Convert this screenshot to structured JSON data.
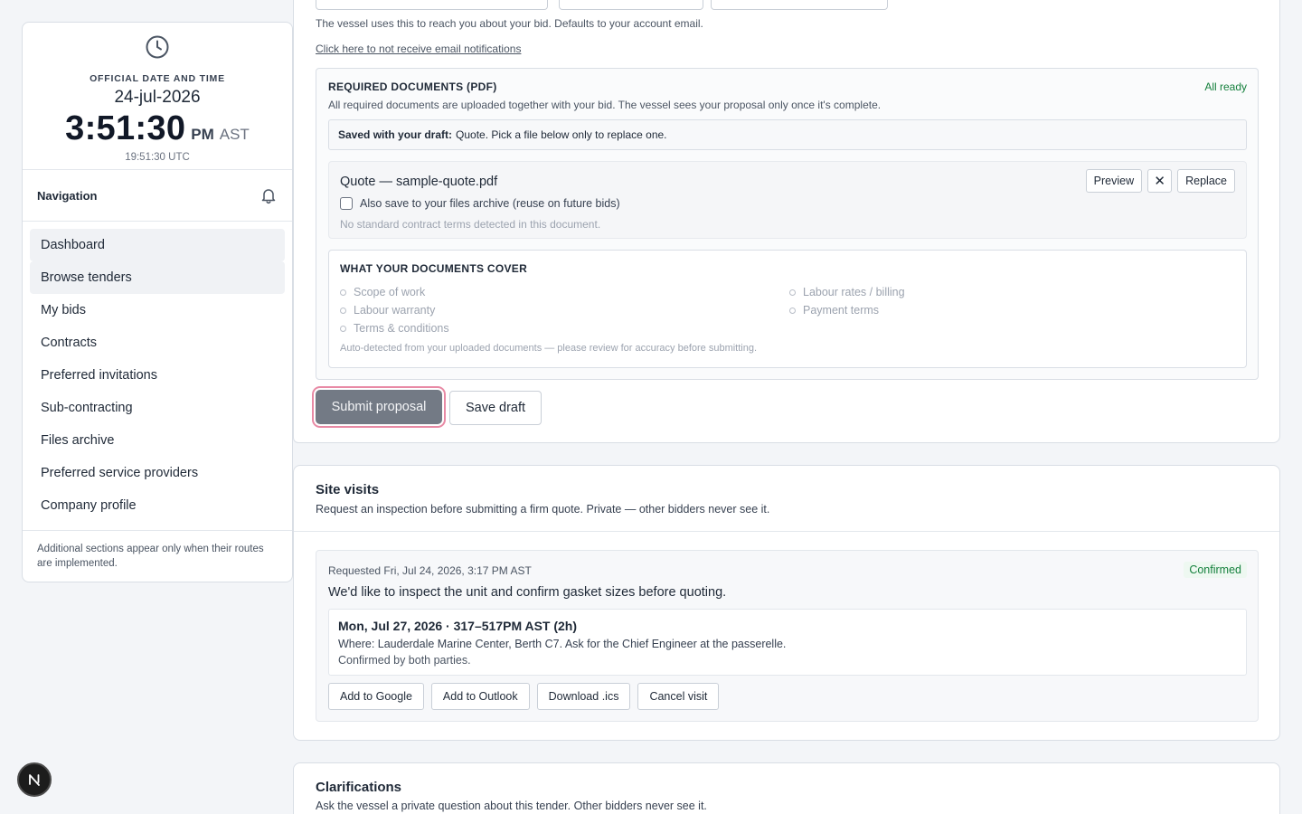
{
  "clock": {
    "caption": "OFFICIAL DATE AND TIME",
    "date": "24-jul-2026",
    "time": "3:51:30",
    "ampm": "PM",
    "tz": "AST",
    "utc": "19:51:30 UTC"
  },
  "nav": {
    "title": "Navigation",
    "items": [
      {
        "label": "Dashboard"
      },
      {
        "label": "Browse tenders"
      },
      {
        "label": "My bids"
      },
      {
        "label": "Contracts"
      },
      {
        "label": "Preferred invitations"
      },
      {
        "label": "Sub-contracting"
      },
      {
        "label": "Files archive"
      },
      {
        "label": "Preferred service providers"
      },
      {
        "label": "Company profile"
      }
    ],
    "note": "Additional sections appear only when their routes are implemented."
  },
  "bid": {
    "email_hint": "The vessel uses this to reach you about your bid. Defaults to your account email.",
    "email_optout": "Click here to not receive email notifications",
    "docs": {
      "title": "REQUIRED DOCUMENTS (PDF)",
      "status": "All ready",
      "subtitle": "All required documents are uploaded together with your bid. The vessel sees your proposal only once it's complete.",
      "saved_label": "Saved with your draft:",
      "saved_text": "Quote. Pick a file below only to replace one.",
      "file": {
        "name": "Quote — sample-quote.pdf",
        "archive_label": "Also save to your files archive (reuse on future bids)",
        "note": "No standard contract terms detected in this document.",
        "preview_label": "Preview",
        "remove_label": "✕",
        "replace_label": "Replace"
      },
      "cover": {
        "title": "WHAT YOUR DOCUMENTS COVER",
        "left": [
          "Scope of work",
          "Labour warranty",
          "Terms & conditions"
        ],
        "right": [
          "Labour rates / billing",
          "Payment terms"
        ],
        "footer": "Auto-detected from your uploaded documents — please review for accuracy before submitting."
      }
    },
    "submit_label": "Submit proposal",
    "draft_label": "Save draft"
  },
  "site_visits": {
    "title": "Site visits",
    "subtitle": "Request an inspection before submitting a firm quote. Private — other bidders never see it.",
    "visit": {
      "requested": "Requested Fri, Jul 24, 2026, 3:17 PM AST",
      "status": "Confirmed",
      "message": "We'd like to inspect the unit and confirm gasket sizes before quoting.",
      "when": "Mon, Jul 27, 2026 · 317–517PM AST (2h)",
      "where": "Where: Lauderdale Marine Center, Berth C7. Ask for the Chief Engineer at the passerelle.",
      "confirmed": "Confirmed by both parties.",
      "actions": [
        "Add to Google",
        "Add to Outlook",
        "Download .ics",
        "Cancel visit"
      ]
    }
  },
  "clarifications": {
    "title": "Clarifications",
    "subtitle": "Ask the vessel a private question about this tender. Other bidders never see it."
  },
  "badge": {
    "letter": "N"
  },
  "colors": {
    "ready_green": "#15803d",
    "submit_gray": "#737a85",
    "focus_ring": "#e88aa5"
  }
}
